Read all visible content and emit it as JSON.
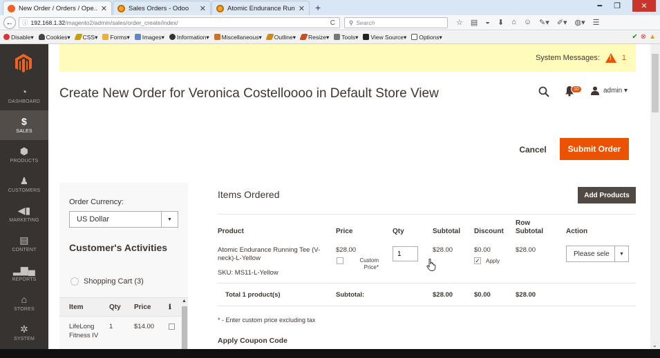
{
  "browser": {
    "tabs": [
      {
        "title": "New Order / Orders / Ope...",
        "active": true
      },
      {
        "title": "Sales Orders - Odoo",
        "active": false
      },
      {
        "title": "Atomic Endurance Runnin...",
        "active": false
      }
    ],
    "new_tab": "+",
    "url_host": "192.168.1.32",
    "url_path": "/magento2/admin/sales/order_create/index/",
    "search_placeholder": "Search"
  },
  "devbar": {
    "items": [
      "Disable▾",
      "Cookies▾",
      "CSS▾",
      "Forms▾",
      "Images▾",
      "Information▾",
      "Miscellaneous▾",
      "Outline▾",
      "Resize▾",
      "Tools▾",
      "View Source▾",
      "Options▾"
    ]
  },
  "sidebar": {
    "items": [
      {
        "label": "DASHBOARD",
        "icon": "gauge-icon"
      },
      {
        "label": "SALES",
        "icon": "dollar-icon",
        "active": true
      },
      {
        "label": "PRODUCTS",
        "icon": "cube-icon"
      },
      {
        "label": "CUSTOMERS",
        "icon": "person-icon"
      },
      {
        "label": "MARKETING",
        "icon": "megaphone-icon"
      },
      {
        "label": "CONTENT",
        "icon": "layout-icon"
      },
      {
        "label": "REPORTS",
        "icon": "bar-chart-icon"
      },
      {
        "label": "STORES",
        "icon": "store-icon"
      },
      {
        "label": "SYSTEM",
        "icon": "gear-icon"
      }
    ]
  },
  "system_messages": {
    "label": "System Messages:",
    "count": "1"
  },
  "header": {
    "title": "Create New Order for Veronica Costelloooo in Default Store View",
    "notifications_count": "10",
    "user": "admin ▾"
  },
  "actions": {
    "cancel": "Cancel",
    "submit": "Submit Order"
  },
  "left_panel": {
    "currency_label": "Order Currency:",
    "currency_value": "US Dollar",
    "activities_title": "Customer's Activities",
    "shopping_cart": "Shopping Cart (3)",
    "table_headers": [
      "Item",
      "Qty",
      "Price"
    ],
    "rows": [
      {
        "item": "LifeLong Fitness IV",
        "qty": "1",
        "price": "$14.00"
      }
    ]
  },
  "items_ordered": {
    "title": "Items Ordered",
    "add_products": "Add Products",
    "headers": {
      "product": "Product",
      "price": "Price",
      "qty": "Qty",
      "subtotal": "Subtotal",
      "discount": "Discount",
      "row_subtotal": "Row Subtotal",
      "action": "Action"
    },
    "item": {
      "name": "Atomic Endurance Running Tee (V-neck)-L-Yellow",
      "sku": "SKU: MS11-L-Yellow",
      "price": "$28.00",
      "custom_price_label": "Custom Price*",
      "qty": "1",
      "subtotal": "$28.00",
      "discount": "$0.00",
      "apply_label": "Apply",
      "row_subtotal": "$28.00",
      "action": "Please sele"
    },
    "totals": {
      "label": "Total 1 product(s)",
      "subtotal_label": "Subtotal:",
      "subtotal": "$28.00",
      "discount": "$0.00",
      "row_subtotal": "$28.00"
    },
    "note": "* - Enter custom price excluding tax",
    "coupon_title": "Apply Coupon Code"
  },
  "colors": {
    "accent": "#eb5202",
    "sidebar": "#373330",
    "notice": "#fffbbb"
  }
}
